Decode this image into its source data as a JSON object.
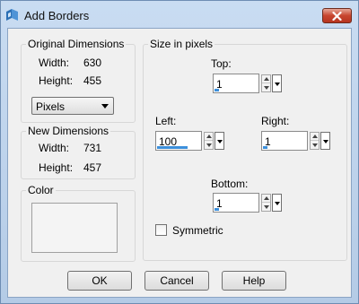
{
  "window": {
    "title": "Add Borders",
    "colors": {
      "titlebar": "#c9dcf2",
      "close_button": "#c7452f",
      "client_bg": "#f0f0f0",
      "accent": "#3c8fdb"
    }
  },
  "original_dimensions": {
    "group_label": "Original Dimensions",
    "width_label": "Width:",
    "width_value": "630",
    "height_label": "Height:",
    "height_value": "455",
    "units_selected": "Pixels"
  },
  "new_dimensions": {
    "group_label": "New Dimensions",
    "width_label": "Width:",
    "width_value": "731",
    "height_label": "Height:",
    "height_value": "457"
  },
  "color_group": {
    "group_label": "Color",
    "swatch_color": "#f4f4f4"
  },
  "size_group": {
    "group_label": "Size in pixels",
    "top_label": "Top:",
    "top_value": "1",
    "left_label": "Left:",
    "left_value": "100",
    "right_label": "Right:",
    "right_value": "1",
    "bottom_label": "Bottom:",
    "bottom_value": "1",
    "symmetric_label": "Symmetric",
    "symmetric_checked": false
  },
  "buttons": {
    "ok": "OK",
    "cancel": "Cancel",
    "help": "Help"
  },
  "icons": {
    "app": "add-borders-app-icon",
    "close": "close-icon"
  }
}
